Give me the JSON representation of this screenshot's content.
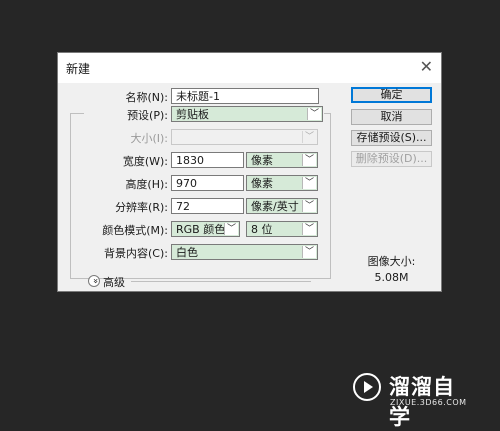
{
  "dialog": {
    "title": "新建",
    "close_glyph": "✕"
  },
  "form": {
    "name_label": "名称(N):",
    "name_value": "未标题-1",
    "preset_label": "预设(P):",
    "preset_value": "剪贴板",
    "size_label": "大小(I):",
    "size_value": "",
    "width_label": "宽度(W):",
    "width_value": "1830",
    "width_unit": "像素",
    "height_label": "高度(H):",
    "height_value": "970",
    "height_unit": "像素",
    "resolution_label": "分辨率(R):",
    "resolution_value": "72",
    "resolution_unit": "像素/英寸",
    "color_mode_label": "颜色模式(M):",
    "color_mode_value": "RGB 颜色",
    "bit_depth_value": "8 位",
    "background_label": "背景内容(C):",
    "background_value": "白色",
    "advanced_label": "高级",
    "dropdown_glyph": "﹀",
    "expand_glyph": "»"
  },
  "buttons": {
    "ok": "确定",
    "cancel": "取消",
    "save_preset": "存储预设(S)...",
    "delete_preset": "删除预设(D)..."
  },
  "info": {
    "image_size_label": "图像大小:",
    "image_size_value": "5.08M"
  },
  "watermark": {
    "brand": "溜溜自学",
    "url": "ZIXUE.3D66.COM"
  }
}
